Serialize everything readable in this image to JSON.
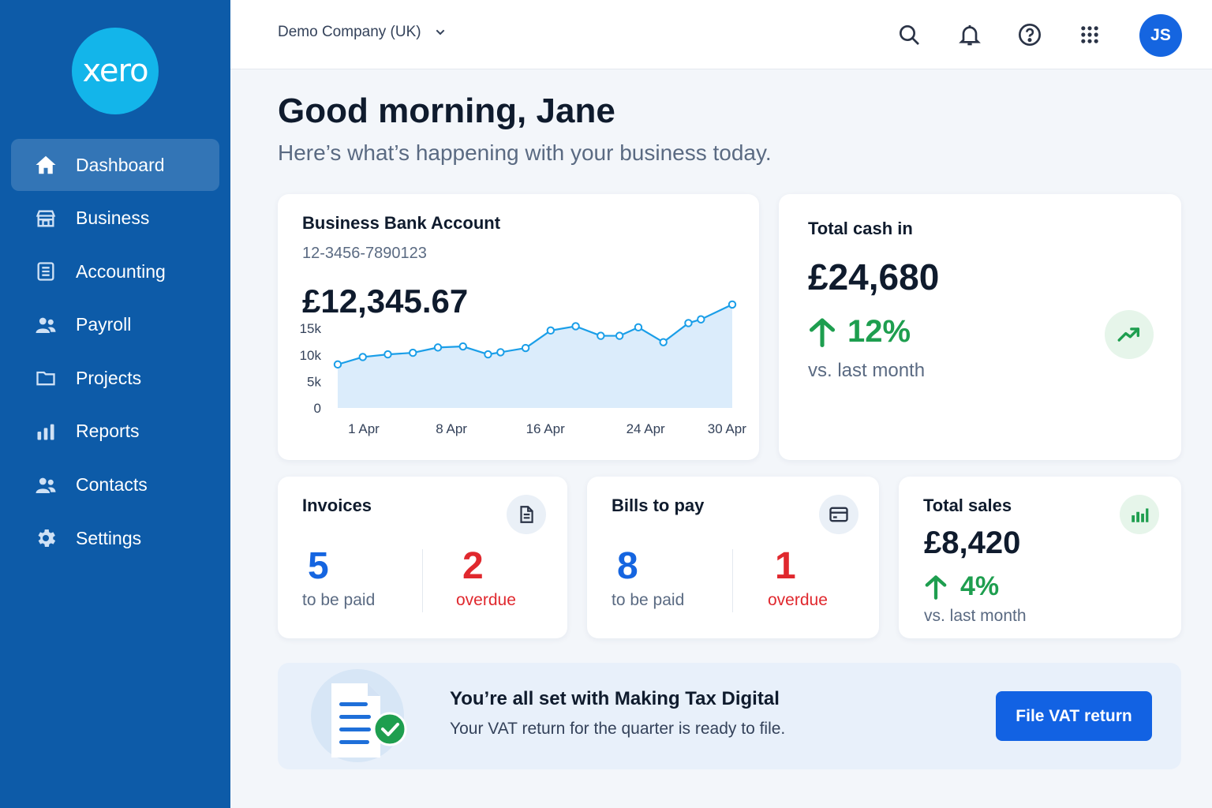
{
  "brand": {
    "logo_text": "xero",
    "logo_color": "#13b5ea",
    "sidebar_color": "#0d5ba8"
  },
  "sidebar": {
    "items": [
      {
        "label": "Dashboard",
        "icon": "home-icon",
        "active": true
      },
      {
        "label": "Business",
        "icon": "store-icon"
      },
      {
        "label": "Accounting",
        "icon": "ledger-icon"
      },
      {
        "label": "Payroll",
        "icon": "people-icon"
      },
      {
        "label": "Projects",
        "icon": "folder-icon"
      },
      {
        "label": "Reports",
        "icon": "bar-chart-icon"
      },
      {
        "label": "Contacts",
        "icon": "contacts-icon"
      },
      {
        "label": "Settings",
        "icon": "gear-icon"
      }
    ]
  },
  "topbar": {
    "company": "Demo Company (UK)",
    "icons": [
      "search-icon",
      "bell-icon",
      "help-icon",
      "apps-grid-icon"
    ],
    "avatar_initials": "JS"
  },
  "greeting": {
    "title": "Good morning, Jane",
    "subtitle": "Here’s what’s happening with your business today."
  },
  "bank_account": {
    "title": "Business Bank Account",
    "account_number": "12-3456-7890123",
    "balance": "£12,345.67"
  },
  "chart_data": {
    "type": "area",
    "title": "",
    "xlabel": "",
    "ylabel": "",
    "ylim": [
      0,
      18000
    ],
    "yticks": [
      "0",
      "5k",
      "10k",
      "15k"
    ],
    "ytick_values": [
      0,
      5000,
      10000,
      15000
    ],
    "xticks": [
      "1 Apr",
      "8 Apr",
      "16 Apr",
      "24 Apr",
      "30 Apr"
    ],
    "xtick_values": [
      1,
      8,
      15.5,
      23.5,
      30
    ],
    "x": [
      1,
      3,
      5,
      7,
      9,
      11,
      13,
      14,
      16,
      18,
      20,
      22,
      23.5,
      25,
      27,
      29,
      30,
      32.5
    ],
    "values": [
      8200,
      9600,
      10100,
      10400,
      11400,
      11600,
      10100,
      10500,
      11300,
      14600,
      15400,
      13600,
      13600,
      15200,
      12400,
      16000,
      16700,
      19500
    ],
    "grid": false,
    "legend": "none"
  },
  "cash_in": {
    "title": "Total cash in",
    "amount": "£24,680",
    "change": "12%",
    "comparison": "vs. last month"
  },
  "invoices": {
    "title": "Invoices",
    "to_be_paid_count": "5",
    "to_be_paid_label": "to be paid",
    "overdue_count": "2",
    "overdue_label": "overdue"
  },
  "bills": {
    "title": "Bills to pay",
    "to_be_paid_count": "8",
    "to_be_paid_label": "to be paid",
    "overdue_count": "1",
    "overdue_label": "overdue"
  },
  "sales": {
    "title": "Total sales",
    "amount": "£8,420",
    "change": "4%",
    "comparison": "vs. last month"
  },
  "banner": {
    "title": "You’re all set with Making Tax Digital",
    "description": "Your VAT return for the quarter is ready to file.",
    "button": "File VAT return"
  }
}
